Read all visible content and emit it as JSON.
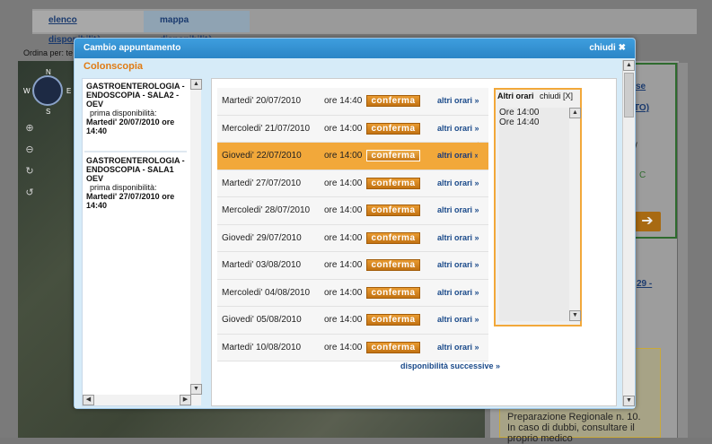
{
  "background": {
    "tabs": [
      "elenco disponibilità",
      "mappa disponibilità"
    ],
    "sort_label": "Ordina per: te",
    "map_compass": {
      "n": "N",
      "s": "S",
      "w": "W",
      "e": "E"
    },
    "right_links": [
      "se",
      "TO)",
      "29 -"
    ],
    "right_slash": "/",
    "right_c": "C",
    "info_text": "Preparazione Regionale n. 10. In caso di dubbi, consultare il proprio medico"
  },
  "modal": {
    "title": "Cambio appuntamento",
    "close_label": "chiudi",
    "section_title": "Colonscopia"
  },
  "units": [
    {
      "name": "GASTROENTEROLOGIA - ENDOSCOPIA - SALA2 - OEV",
      "first_label": "prima disponibilità:",
      "first_value": "Martedi' 20/07/2010 ore 14:40"
    },
    {
      "name": "GASTROENTEROLOGIA - ENDOSCOPIA - SALA1 OEV",
      "first_label": "prima disponibilità:",
      "first_value": "Martedi' 27/07/2010 ore 14:40"
    }
  ],
  "slots": [
    {
      "date": "Martedi' 20/07/2010",
      "time": "ore 14:40",
      "confirm": "conferma",
      "other": "altri orari »",
      "selected": false
    },
    {
      "date": "Mercoledi' 21/07/2010",
      "time": "ore 14:00",
      "confirm": "conferma",
      "other": "altri orari »",
      "selected": false
    },
    {
      "date": "Giovedi' 22/07/2010",
      "time": "ore 14:00",
      "confirm": "conferma",
      "other": "altri orari »",
      "selected": true
    },
    {
      "date": "Martedi' 27/07/2010",
      "time": "ore 14:00",
      "confirm": "conferma",
      "other": "altri orari »",
      "selected": false
    },
    {
      "date": "Mercoledi' 28/07/2010",
      "time": "ore 14:00",
      "confirm": "conferma",
      "other": "altri orari »",
      "selected": false
    },
    {
      "date": "Giovedi' 29/07/2010",
      "time": "ore 14:00",
      "confirm": "conferma",
      "other": "altri orari »",
      "selected": false
    },
    {
      "date": "Martedi' 03/08/2010",
      "time": "ore 14:00",
      "confirm": "conferma",
      "other": "altri orari »",
      "selected": false
    },
    {
      "date": "Mercoledi' 04/08/2010",
      "time": "ore 14:00",
      "confirm": "conferma",
      "other": "altri orari »",
      "selected": false
    },
    {
      "date": "Giovedi' 05/08/2010",
      "time": "ore 14:00",
      "confirm": "conferma",
      "other": "altri orari »",
      "selected": false
    },
    {
      "date": "Martedi' 10/08/2010",
      "time": "ore 14:00",
      "confirm": "conferma",
      "other": "altri orari »",
      "selected": false
    }
  ],
  "more_slots_label": "disponibilità successive »",
  "other_times": {
    "title": "Altri orari",
    "close_label": "chiudi [X]",
    "times": [
      "Ore 14:00",
      "Ore 14:40"
    ]
  },
  "colors": {
    "accent_orange": "#f2a83a",
    "header_blue": "#2b85c6",
    "link_blue": "#1a4a8a"
  }
}
